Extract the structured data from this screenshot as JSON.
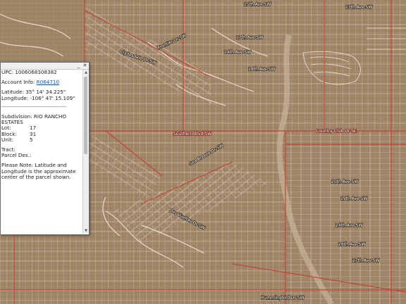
{
  "popup": {
    "upc_label": "UPC:",
    "upc_value": "1006068308382",
    "account_label": "Account Info:",
    "account_link": "R064710",
    "latitude_label": "Latitude:",
    "latitude_value": "35° 14' 34.225\"",
    "longitude_label": "Longitude:",
    "longitude_value": "-106° 47' 15.109\"",
    "divider": "----------------------------------------",
    "subdivision_label": "Subdivision:",
    "subdivision_value": "RIO RANCHO",
    "subdivision_value2": "ESTATES",
    "lot_label": "Lot:",
    "lot_value": "17",
    "block_label": "Block:",
    "block_value": "31",
    "unit_label": "Unit:",
    "unit_value": "5",
    "tract_label": "Tract:",
    "parcel_label": "Parcel Des.:",
    "note": "Please Note: Latitude and Longitude is the approximate center of the parcel shown.",
    "minimize_icon": "underscore",
    "close_icon": "x"
  },
  "map": {
    "street_labels": [
      "Southern Blvd SW",
      "20th Ave SW",
      "19th Ave SW",
      "17th Ave SW",
      "18th Ave SW",
      "15th Ave SW",
      "13th Ave SW",
      "14th Ave SW",
      "24th Ave SW",
      "26th Ave SW",
      "27th Ave SW",
      "Clydesdale Dr SW",
      "Sea Breeze Dr SW",
      "Dos Vueltas Dr SW",
      "Frontier Dr SW",
      "Country Club Dr SE",
      "Hummingbird Dr SW"
    ],
    "colors": {
      "imagery": "#a3896a",
      "parcel_lines": "#ffffff",
      "major_roads": "#c2443a"
    }
  }
}
